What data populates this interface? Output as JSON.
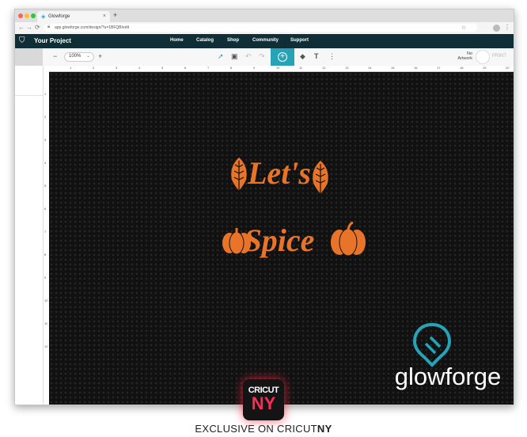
{
  "browser": {
    "tab_title": "Glowforge",
    "tab_close": "×",
    "new_tab": "+",
    "url": "app.glowforge.com/design/?u=1BFQB/edit",
    "nav_back": "←",
    "nav_forward": "→",
    "nav_reload": "⟳",
    "menu": "⋮"
  },
  "app": {
    "project_title": "Your Project",
    "nav": [
      "Home",
      "Catalog",
      "Shop",
      "Community",
      "Support"
    ],
    "accent_color": "#27a3b7",
    "header_color": "#0f2e36"
  },
  "toolbar": {
    "zoom_minus": "−",
    "zoom_value": "100%",
    "zoom_plus": "+",
    "status_line1": "No",
    "status_line2": "Artwork",
    "print_label": "PRINT"
  },
  "ruler": {
    "top_ticks": [
      "1",
      "2",
      "3",
      "4",
      "5",
      "6",
      "7",
      "8",
      "9",
      "10",
      "11",
      "12",
      "13",
      "14",
      "15",
      "16",
      "17",
      "18",
      "19",
      "20"
    ],
    "left_ticks": [
      "1",
      "2",
      "3",
      "4",
      "5",
      "6",
      "7",
      "8",
      "9",
      "10",
      "11",
      "12"
    ]
  },
  "design": {
    "line1": "Let's",
    "line2": "Spice",
    "color": "#e8742a",
    "logo_text": "glowforge"
  },
  "branding": {
    "badge_line1": "CRICUT",
    "badge_line2": "NY",
    "footer_prefix": "EXCLUSIVE ON CRICUT",
    "footer_bold": "NY"
  }
}
